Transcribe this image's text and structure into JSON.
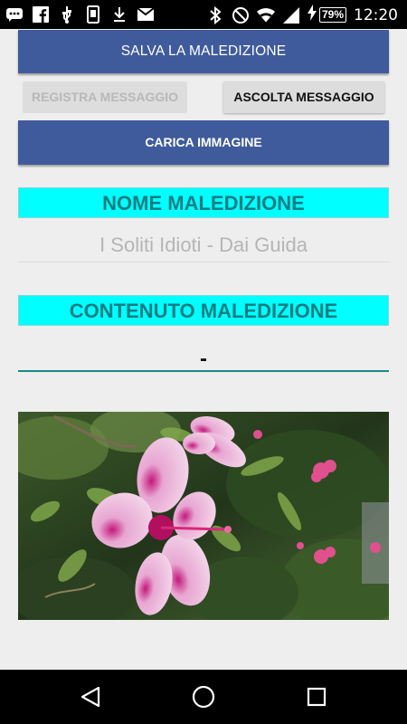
{
  "status_bar": {
    "time": "12:20",
    "battery": "79%",
    "icons_left": [
      "chat-icon",
      "facebook-icon",
      "usb-icon",
      "storage-icon",
      "download-icon",
      "gmail-icon"
    ],
    "icons_right": [
      "bluetooth-icon",
      "do-not-disturb-icon",
      "wifi-icon",
      "signal-icon",
      "charging-icon"
    ]
  },
  "buttons": {
    "save_label": "SALVA LA MALEDIZIONE",
    "record_label": "REGISTRA MESSAGGIO",
    "listen_label": "ASCOLTA MESSAGGIO",
    "load_image_label": "CARICA IMMAGINE"
  },
  "name_section": {
    "label": "NOME MALEDIZIONE",
    "value": "I Soliti Idioti - Dai Guida"
  },
  "content_section": {
    "label": "CONTENUTO MALEDIZIONE",
    "value": "-"
  },
  "colors": {
    "primary_button": "#3f5b9c",
    "label_background": "#00ffff",
    "label_text": "#0b7d82",
    "field_underline": "#1a8a86",
    "background": "#eeeeee"
  },
  "nav_bar": {
    "icons": [
      "back-icon",
      "home-icon",
      "recents-icon"
    ]
  }
}
